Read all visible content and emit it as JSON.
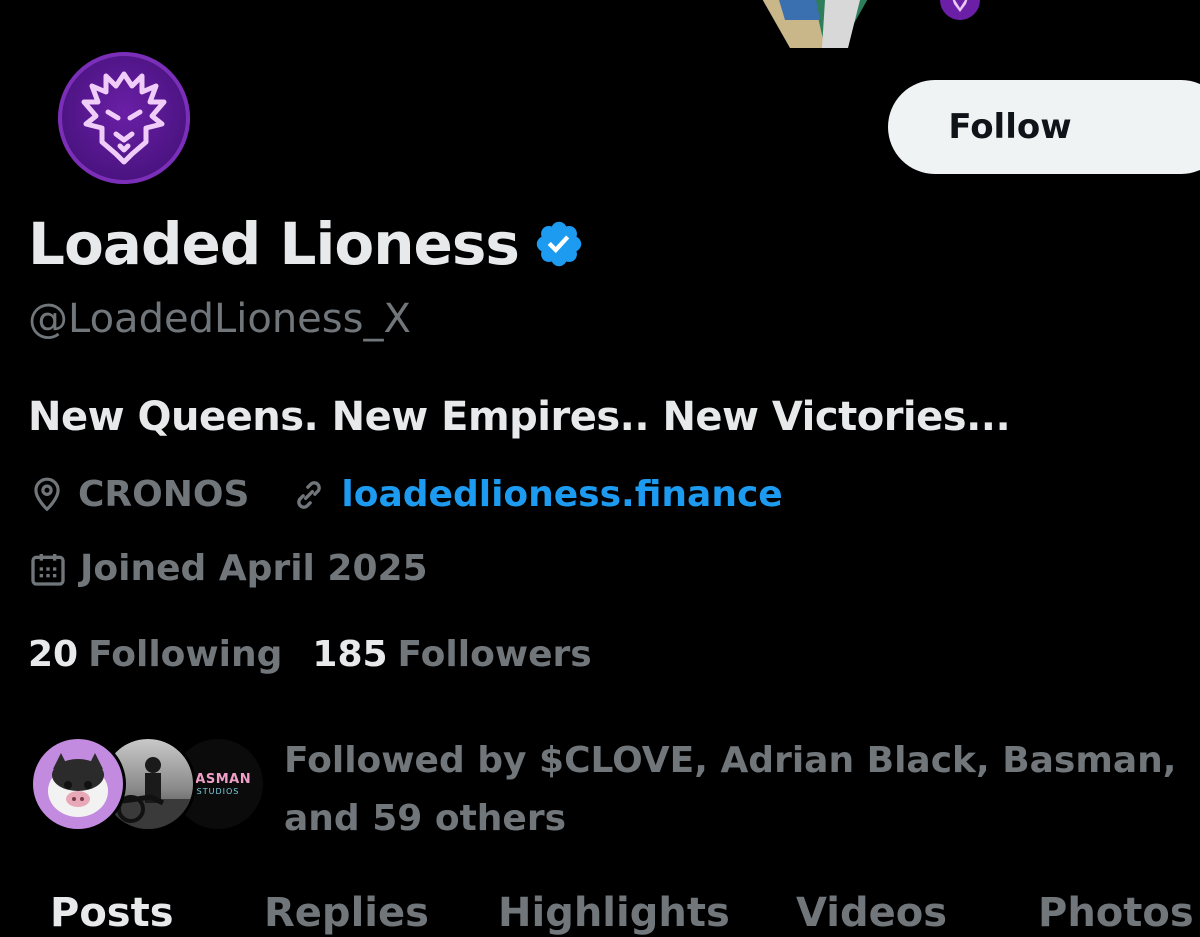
{
  "profile": {
    "display_name": "Loaded Lioness",
    "handle": "@LoadedLioness_X",
    "bio": "New Queens. New Empires.. New Victories...",
    "location": "CRONOS",
    "website": "loadedlioness.finance",
    "joined": "Joined April 2025"
  },
  "actions": {
    "follow_label": "Follow"
  },
  "stats": {
    "following_count": "20",
    "following_label": "Following",
    "followers_count": "185",
    "followers_label": "Followers"
  },
  "followed_by": {
    "text_line1": "Followed by $CLOVE, Adrian Black, Basman,",
    "text_line2": "and 59 others",
    "avatar3_title": "BASMAN",
    "avatar3_sub": "STUDIOS"
  },
  "tabs": [
    "Posts",
    "Replies",
    "Highlights",
    "Videos",
    "Photos"
  ],
  "colors": {
    "background": "#000000",
    "primary_text": "#e7e9ea",
    "secondary_text": "#71767b",
    "link": "#1d9bf0",
    "verified": "#1d9bf0",
    "avatar_purple": "#5a189a"
  },
  "icons": {
    "verified": "verified-badge-icon",
    "location": "location-pin-icon",
    "link": "link-icon",
    "calendar": "calendar-icon"
  }
}
